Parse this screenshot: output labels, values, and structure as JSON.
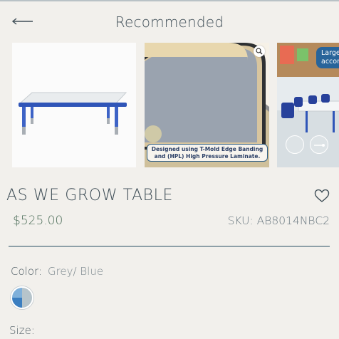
{
  "header": {
    "title": "Recommended",
    "back_icon": "arrow-left-icon"
  },
  "gallery": {
    "slides": [
      {
        "name": "product-image-table"
      },
      {
        "name": "product-image-edge-detail",
        "caption_line1": "Designed using T-Mold Edge Banding",
        "caption_line2": "and (HPL) High Pressure Laminate."
      },
      {
        "name": "product-image-classroom",
        "badge_line1": "Large",
        "badge_line2": "accom"
      }
    ]
  },
  "product": {
    "title": "AS WE GROW TABLE",
    "price": "$525.00",
    "sku": "SKU: AB8014NBC2",
    "color_label": "Color:",
    "color_value": "Grey/ Blue",
    "size_label": "Size:"
  },
  "colors": {
    "accent_price": "#4f6f5b",
    "divider": "#8ea0a8",
    "background": "#f2f0ec"
  }
}
